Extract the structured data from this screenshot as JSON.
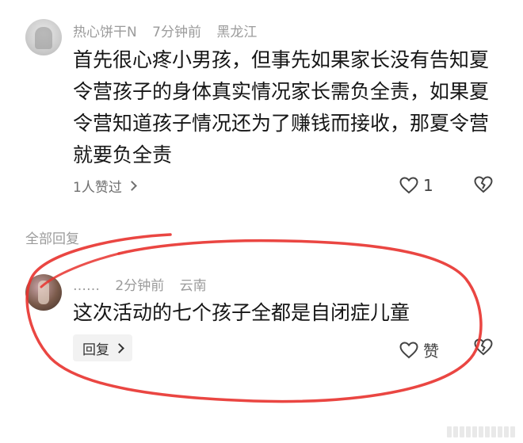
{
  "comments": [
    {
      "user": "热心饼干N",
      "time": "7分钟前",
      "location": "黑龙江",
      "text": "首先很心疼小男孩，但事先如果家长没有告知夏令营孩子的身体真实情况家长需负全责，如果夏令营知道孩子情况还为了赚钱而接收，那夏令营就要负全责",
      "likes_summary": "1人赞过",
      "like_count": "1"
    },
    {
      "user": "……",
      "time": "2分钟前",
      "location": "云南",
      "text": "这次活动的七个孩子全都是自闭症儿童",
      "reply_label": "回复",
      "like_label": "赞"
    }
  ],
  "section": {
    "all_replies_label": "全部回复"
  },
  "icons": {
    "like": "heart-outline-icon",
    "dislike": "broken-heart-icon",
    "chevron": "chevron-right-icon"
  },
  "colors": {
    "annotation": "#e8322e",
    "meta": "#9b9b9b",
    "text": "#161616"
  }
}
